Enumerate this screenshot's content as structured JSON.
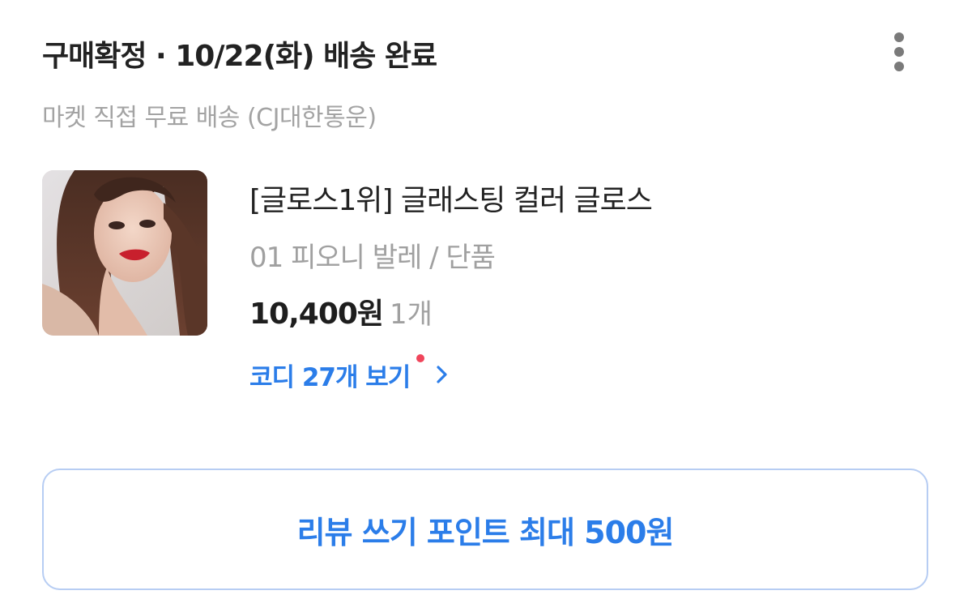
{
  "order": {
    "status_title": "구매확정 · 10/22(화) 배송 완료",
    "shipping_info": "마켓 직접 무료 배송 (CJ대한통운)"
  },
  "product": {
    "name": "[글로스1위] 글래스팅 컬러 글로스",
    "option": "01 피오니 발레 / 단품",
    "price": "10,400원",
    "quantity": "1개",
    "thumbnail_icon": "product-photo"
  },
  "coordi": {
    "label": "코디 27개 보기",
    "has_new": true
  },
  "review_button": {
    "label": "리뷰 쓰기 포인트 최대 500원"
  },
  "colors": {
    "accent": "#2b7de9",
    "new_badge": "#f0455b",
    "button_border": "#b7cdf3"
  }
}
